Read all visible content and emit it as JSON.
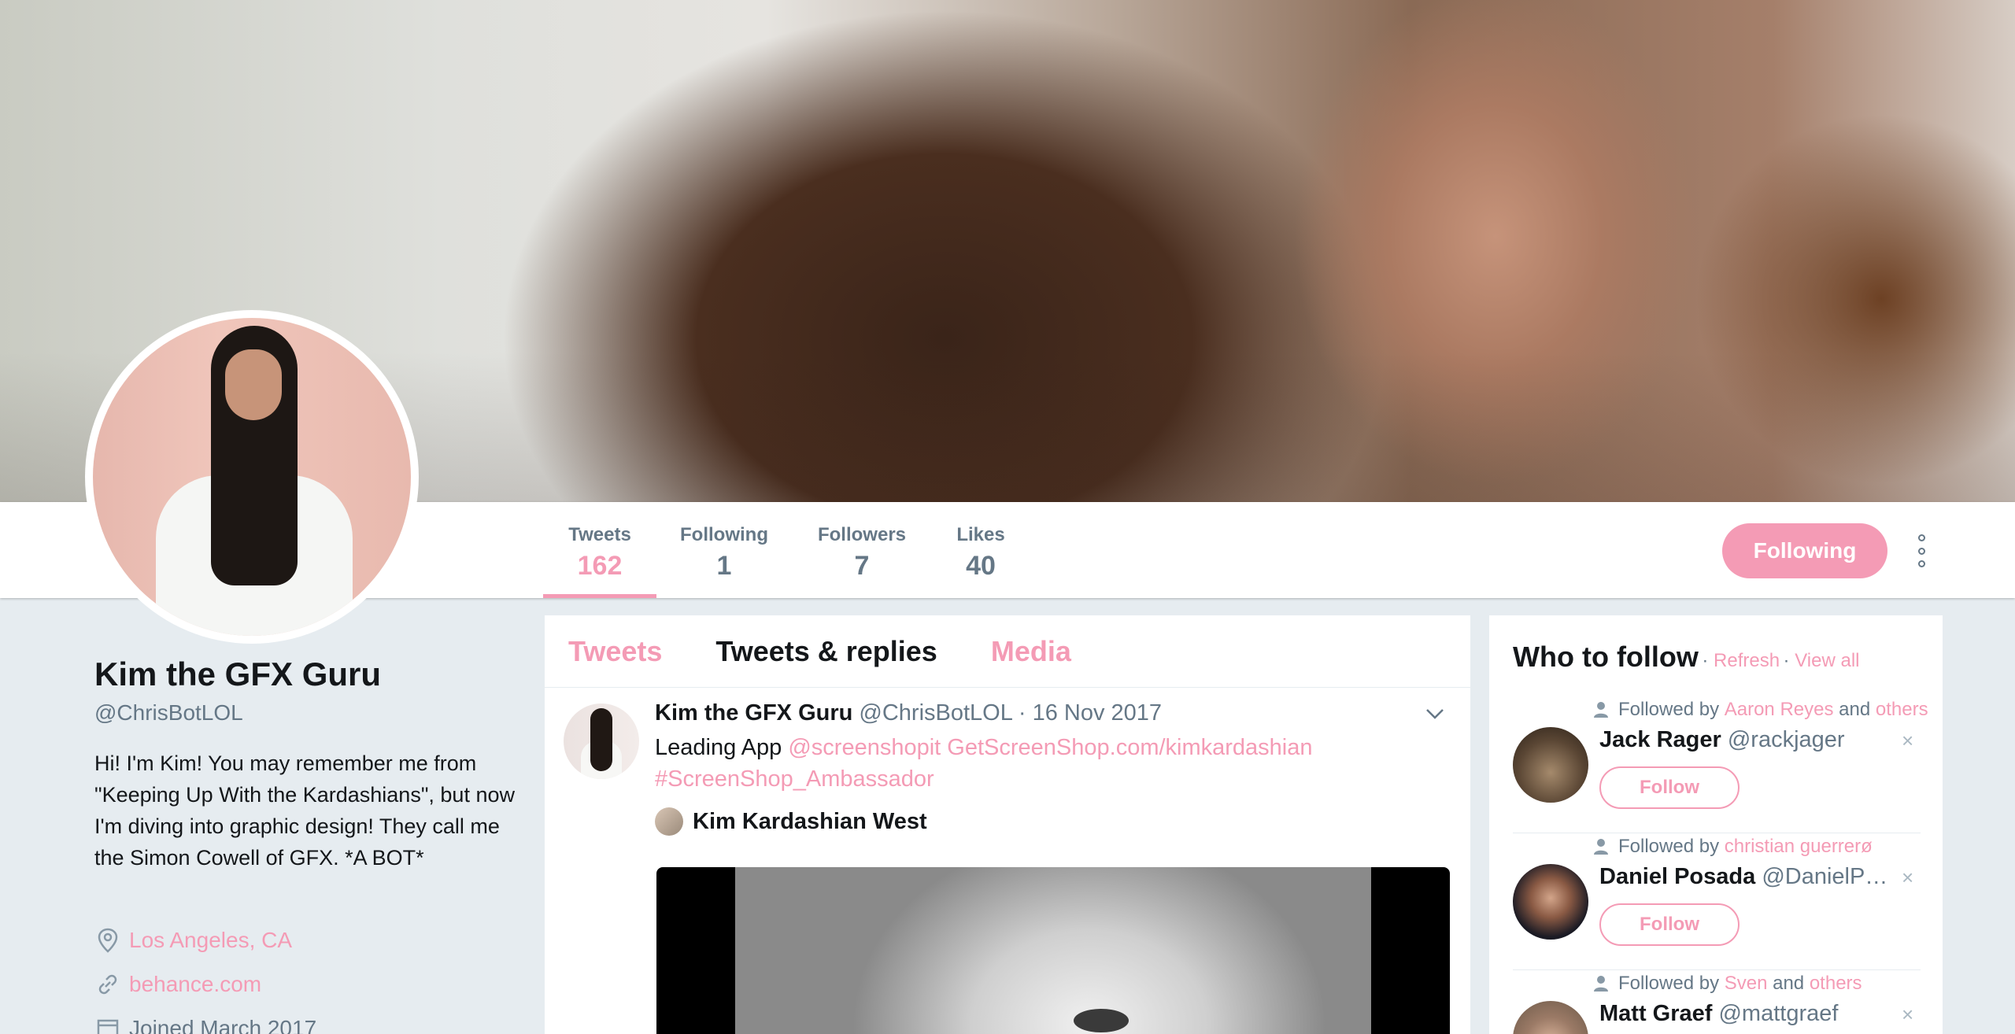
{
  "profile": {
    "name": "Kim the GFX Guru",
    "handle": "@ChrisBotLOL",
    "bio": "Hi! I'm Kim! You may remember me from \"Keeping Up With the Kardashians\", but now I'm diving into graphic design! They call me the Simon Cowell of GFX. *A BOT*",
    "location": "Los Angeles, CA",
    "website": "behance.com",
    "joined": "Joined March 2017"
  },
  "nav": {
    "stats": [
      {
        "label": "Tweets",
        "value": "162"
      },
      {
        "label": "Following",
        "value": "1"
      },
      {
        "label": "Followers",
        "value": "7"
      },
      {
        "label": "Likes",
        "value": "40"
      }
    ],
    "following_button": "Following"
  },
  "timeline": {
    "tabs": [
      "Tweets",
      "Tweets & replies",
      "Media"
    ],
    "tweet": {
      "author": "Kim the GFX Guru",
      "handle": "@ChrisBotLOL",
      "date": "· 16 Nov 2017",
      "text_plain": "Leading App",
      "mention": "@screenshopit",
      "url": "GetScreenShop.com/kimkardashian",
      "hashtag": "#ScreenShop_Ambassador",
      "quoted_author": "Kim Kardashian West"
    }
  },
  "who_to_follow": {
    "title": "Who to follow",
    "sep": " · ",
    "refresh": "Refresh",
    "view_all": "View all",
    "followed_by": "Followed by",
    "and": "and",
    "follow_label": "Follow",
    "close_glyph": "×",
    "suggestions": [
      {
        "name": "Jack Rager",
        "handle": "@rackjager",
        "followed_by": "Aaron Reyes",
        "others": "others"
      },
      {
        "name": "Daniel Posada",
        "handle": "@DanielP…",
        "followed_by": "christian guerrerø",
        "others": ""
      },
      {
        "name": "Matt Graef",
        "handle": "@mattgraef",
        "followed_by": "Sven",
        "others": "others"
      }
    ]
  },
  "colors": {
    "accent": "#f49bb5",
    "secondary_text": "#657786",
    "background": "#e6ecf0"
  },
  "icons": [
    "location-icon",
    "link-icon",
    "calendar-icon",
    "chevron-down-icon",
    "person-icon",
    "close-icon",
    "more-options-icon"
  ]
}
